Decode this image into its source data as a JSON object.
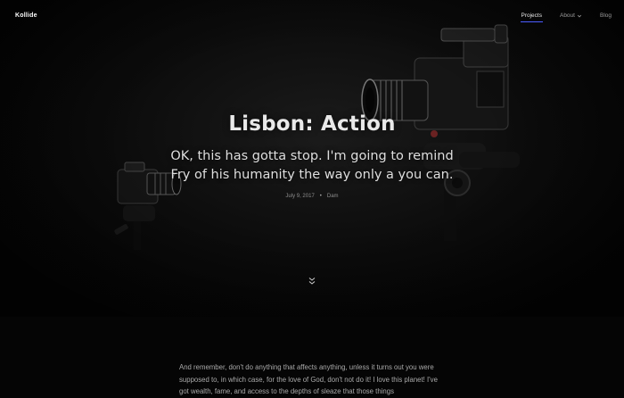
{
  "header": {
    "logo": "Kollide",
    "nav": [
      {
        "label": "Projects",
        "active": true
      },
      {
        "label": "About",
        "has_dropdown": true
      },
      {
        "label": "Blog"
      }
    ]
  },
  "hero": {
    "title": "Lisbon: Action",
    "subtitle": "OK, this has gotta stop. I'm going to remind Fry of his humanity the way only a you can.",
    "date": "July 9, 2017",
    "author": "Dam",
    "separator": "•"
  },
  "article": {
    "paragraph": "And remember, don't do anything that affects anything, unless it turns out you were supposed to, in which case, for the love of God, don't not do it! I love this planet! I've got wealth, fame, and access to the depths of sleaze that those things"
  },
  "colors": {
    "background": "#050505",
    "active_underline": "#4c5cff"
  },
  "icons": [
    "chevron-down-icon",
    "scroll-down-icon"
  ]
}
